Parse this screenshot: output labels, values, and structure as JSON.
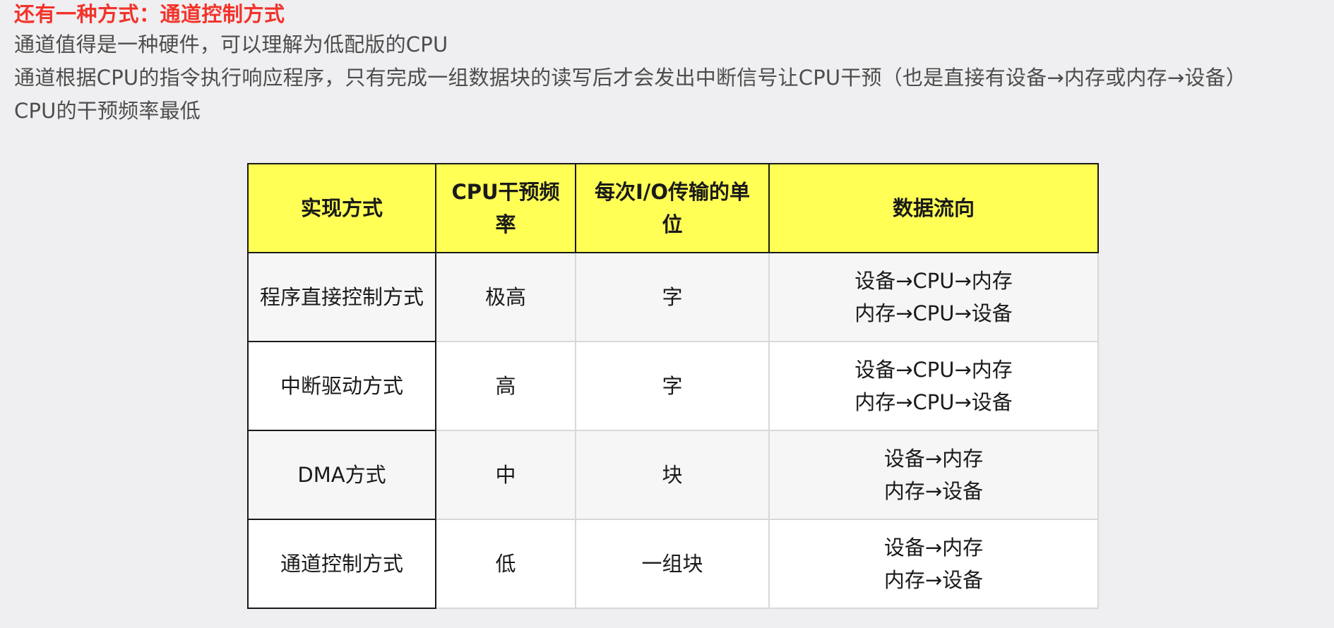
{
  "heading": "还有一种方式：通道控制方式",
  "paragraphs": [
    "通道值得是一种硬件，可以理解为低配版的CPU",
    "通道根据CPU的指令执行响应程序，只有完成一组数据块的读写后才会发出中断信号让CPU干预（也是直接有设备→内存或内存→设备）",
    "CPU的干预频率最低"
  ],
  "table": {
    "headers": [
      "实现方式",
      "CPU干预频率",
      "每次I/O传输的单位",
      "数据流向"
    ],
    "rows": [
      {
        "method": "程序直接控制方式",
        "frequency": "极高",
        "unit": "字",
        "flow": [
          "设备→CPU→内存",
          "内存→CPU→设备"
        ]
      },
      {
        "method": "中断驱动方式",
        "frequency": "高",
        "unit": "字",
        "flow": [
          "设备→CPU→内存",
          "内存→CPU→设备"
        ]
      },
      {
        "method": "DMA方式",
        "frequency": "中",
        "unit": "块",
        "flow": [
          "设备→内存",
          "内存→设备"
        ]
      },
      {
        "method": "通道控制方式",
        "frequency": "低",
        "unit": "一组块",
        "flow": [
          "设备→内存",
          "内存→设备"
        ]
      }
    ]
  },
  "colors": {
    "heading": "#f2332a",
    "header_bg": "#ffff55",
    "page_bg": "#efeff1"
  }
}
